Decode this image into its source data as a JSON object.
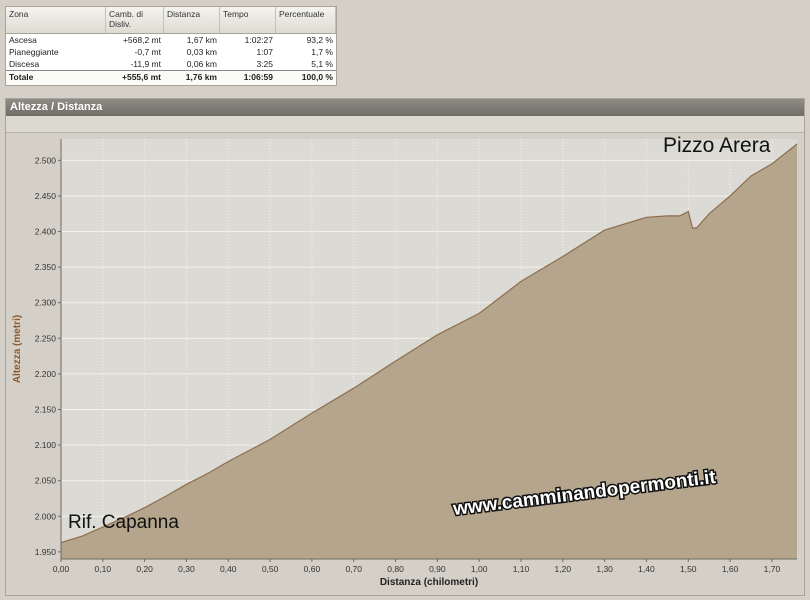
{
  "stats": {
    "columns": [
      "Zona",
      "Camb. di Disliv.",
      "Distanza",
      "Tempo",
      "Percentuale"
    ],
    "rows": [
      [
        "Ascesa",
        "+568,2 mt",
        "1,67 km",
        "1:02:27",
        "93,2 %"
      ],
      [
        "Pianeggiante",
        "-0,7 mt",
        "0,03 km",
        "1:07",
        "1,7 %"
      ],
      [
        "Discesa",
        "-11,9 mt",
        "0,06 km",
        "3:25",
        "5,1 %"
      ]
    ],
    "total": [
      "Totale",
      "+555,6 mt",
      "1,76 km",
      "1:06:59",
      "100,0 %"
    ]
  },
  "panel": {
    "title": "Altezza / Distanza"
  },
  "chart_data": {
    "type": "area",
    "title": "",
    "xlabel": "Distanza (chilometri)",
    "ylabel": "Altezza (metri)",
    "xlim": [
      0,
      1.76
    ],
    "ylim": [
      1940,
      2530
    ],
    "x_ticks": [
      "0,00",
      "0,10",
      "0,20",
      "0,30",
      "0,40",
      "0,50",
      "0,60",
      "0,70",
      "0,80",
      "0,90",
      "1,00",
      "1,10",
      "1,20",
      "1,30",
      "1,40",
      "1,50",
      "1,60",
      "1,70"
    ],
    "y_ticks": [
      "1.950",
      "2.000",
      "2.050",
      "2.100",
      "2.150",
      "2.200",
      "2.250",
      "2.300",
      "2.350",
      "2.400",
      "2.450",
      "2.500"
    ],
    "x": [
      0,
      0.05,
      0.1,
      0.15,
      0.2,
      0.25,
      0.3,
      0.35,
      0.4,
      0.5,
      0.6,
      0.7,
      0.8,
      0.9,
      1.0,
      1.1,
      1.2,
      1.3,
      1.4,
      1.45,
      1.48,
      1.49,
      1.5,
      1.51,
      1.52,
      1.55,
      1.6,
      1.65,
      1.7,
      1.76
    ],
    "y": [
      1963,
      1972,
      1985,
      1998,
      2012,
      2028,
      2045,
      2060,
      2077,
      2108,
      2145,
      2180,
      2218,
      2255,
      2285,
      2330,
      2365,
      2402,
      2420,
      2422,
      2422,
      2425,
      2428,
      2405,
      2405,
      2425,
      2450,
      2478,
      2495,
      2523
    ],
    "fill_color": "#b5a58c",
    "line_color": "#8c6e4e",
    "grid": true,
    "annotations": [
      "Pizzo Arera",
      "Rif. Capanna",
      "www.camminandopermonti.it"
    ]
  }
}
